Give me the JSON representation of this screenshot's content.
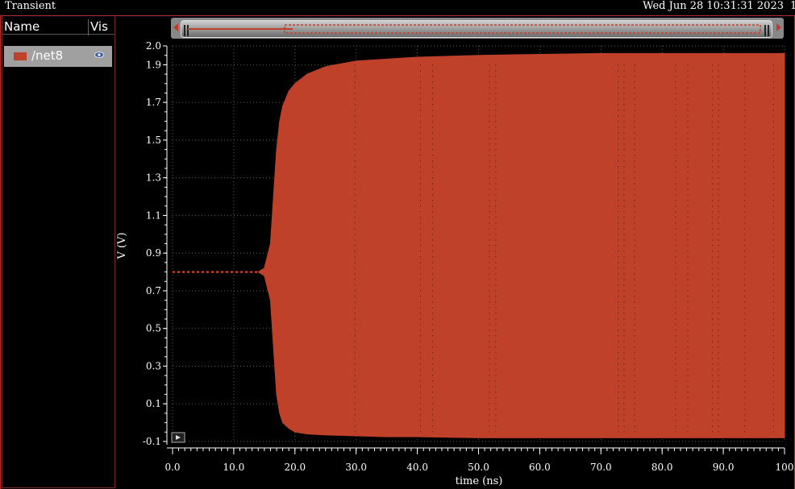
{
  "window": {
    "title": "Transient",
    "datetime": "Wed Jun 28 10:31:31 2023",
    "edge_char": "1"
  },
  "sidebar": {
    "header_name": "Name",
    "header_vis": "Vis",
    "signals": [
      {
        "label": "/net8",
        "color": "#c0412a",
        "icon": "eye-icon"
      }
    ]
  },
  "colors": {
    "trace": "#c0412a",
    "frame": "#b03030",
    "grid": "#5a5a5a"
  },
  "chart_data": {
    "type": "area",
    "xlabel": "time (ns)",
    "ylabel": "V (V)",
    "xlim": [
      0,
      100
    ],
    "ylim": [
      -0.1,
      2.0
    ],
    "x_ticks": [
      "0.0",
      "10.0",
      "20.0",
      "30.0",
      "40.0",
      "50.0",
      "60.0",
      "70.0",
      "80.0",
      "90.0",
      "100"
    ],
    "y_ticks": [
      "-0.1",
      "0.1",
      "0.3",
      "0.5",
      "0.7",
      "0.9",
      "1.1",
      "1.3",
      "1.5",
      "1.7",
      "1.9",
      "2.0"
    ],
    "grid": true,
    "series": [
      {
        "name": "/net8",
        "description_type": "oscillation envelope",
        "x": [
          0,
          14,
          15,
          16,
          16.5,
          17,
          17.5,
          18,
          19,
          20,
          22,
          25,
          30,
          35,
          40,
          50,
          60,
          70,
          80,
          90,
          100
        ],
        "upper": [
          0.8,
          0.8,
          0.82,
          0.95,
          1.2,
          1.45,
          1.6,
          1.68,
          1.76,
          1.8,
          1.85,
          1.89,
          1.92,
          1.93,
          1.94,
          1.95,
          1.955,
          1.96,
          1.96,
          1.96,
          1.96
        ],
        "lower": [
          0.8,
          0.8,
          0.78,
          0.65,
          0.4,
          0.15,
          0.05,
          0.0,
          -0.03,
          -0.05,
          -0.06,
          -0.065,
          -0.07,
          -0.075,
          -0.075,
          -0.08,
          -0.08,
          -0.08,
          -0.08,
          -0.08,
          -0.08
        ]
      }
    ]
  }
}
